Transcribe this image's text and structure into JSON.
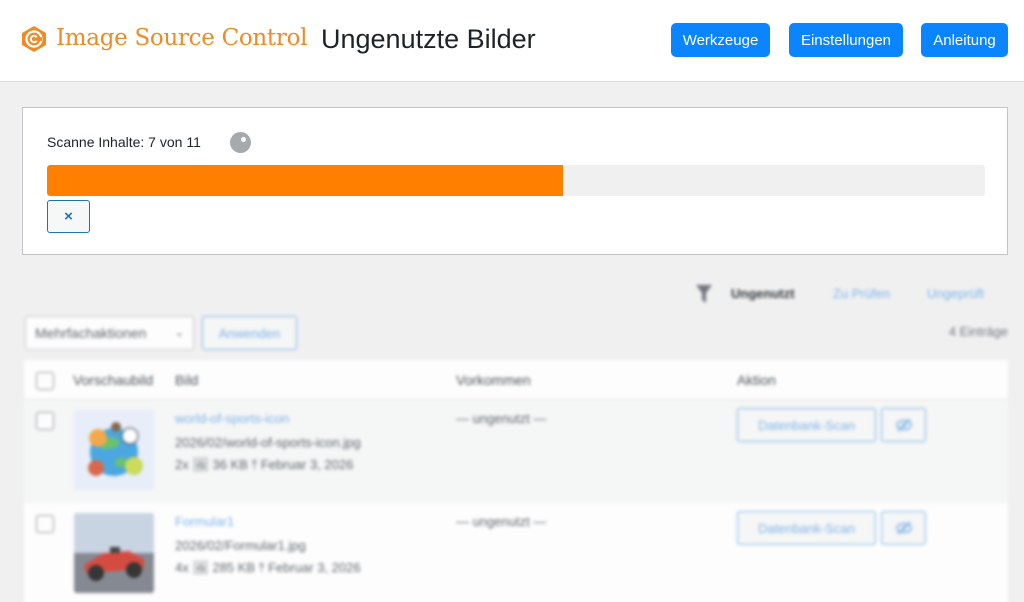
{
  "header": {
    "brand": "Image Source Control",
    "title": "Ungenutzte Bilder",
    "brand_color": "#f08a24",
    "buttons": {
      "tools": "Werkzeuge",
      "settings": "Einstellungen",
      "manual": "Anleitung"
    },
    "button_color": "#0a84ff"
  },
  "scan": {
    "status_text": "Scanne Inhalte: 7 von 11",
    "progress_fraction": 0.55,
    "progress_color": "#ff7f00",
    "cancel_label": "×"
  },
  "filters": {
    "icon": "filter-icon",
    "views": [
      "Ungenutzt",
      "Zu Prüfen",
      "Ungeprüft"
    ],
    "active_view": "Ungenutzt"
  },
  "bulk_actions": {
    "selected": "Mehrfachaktionen",
    "apply_label": "Anwenden"
  },
  "count": "4 Einträge",
  "table": {
    "columns": {
      "preview": "Vorschaubild",
      "image": "Bild",
      "usage": "Vorkommen",
      "action": "Aktion"
    },
    "rows": [
      {
        "thumbnail": "sports-globe-thumbnail",
        "name": "world-of-sports-icon",
        "path": "2026/02/world-of-sports-icon.jpg",
        "meta": "2x  🖼 36 KB  ⤒ Februar 3, 2026",
        "usage": "— ungenutzt —",
        "scan_label": "Datenbank-Scan",
        "hide_icon": "eye-slash-icon"
      },
      {
        "thumbnail": "formula1-car-thumbnail",
        "name": "Formular1",
        "path": "2026/02/Formular1.jpg",
        "meta": "4x  🖼 285 KB  ⤒ Februar 3, 2026",
        "usage": "— ungenutzt —",
        "scan_label": "Datenbank-Scan",
        "hide_icon": "eye-slash-icon"
      }
    ]
  }
}
